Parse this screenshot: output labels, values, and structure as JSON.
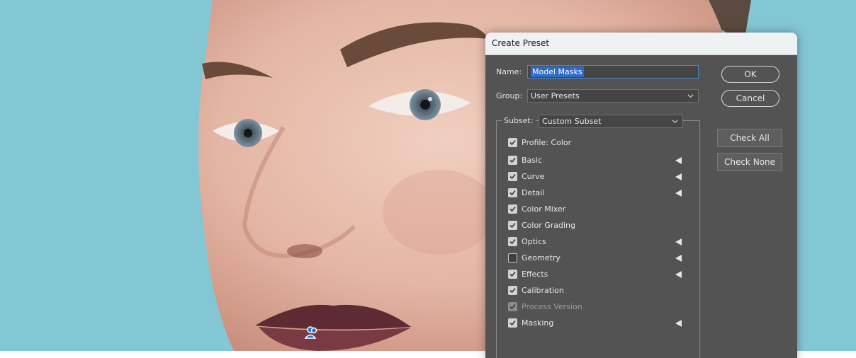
{
  "dialog": {
    "title": "Create Preset",
    "name_label": "Name:",
    "name_value": "Model Masks",
    "group_label": "Group:",
    "group_value": "User Presets",
    "subset_label": "Subset:",
    "subset_value": "Custom Subset",
    "buttons": {
      "ok": "OK",
      "cancel": "Cancel",
      "check_all": "Check All",
      "check_none": "Check None"
    },
    "items": [
      {
        "label": "Profile: Color",
        "checked": true,
        "enabled": true,
        "has_arrow": false
      },
      {
        "label": "Basic",
        "checked": true,
        "enabled": true,
        "has_arrow": true
      },
      {
        "label": "Curve",
        "checked": true,
        "enabled": true,
        "has_arrow": true
      },
      {
        "label": "Detail",
        "checked": true,
        "enabled": true,
        "has_arrow": true
      },
      {
        "label": "Color Mixer",
        "checked": true,
        "enabled": true,
        "has_arrow": false
      },
      {
        "label": "Color Grading",
        "checked": true,
        "enabled": true,
        "has_arrow": false
      },
      {
        "label": "Optics",
        "checked": true,
        "enabled": true,
        "has_arrow": true
      },
      {
        "label": "Geometry",
        "checked": false,
        "enabled": true,
        "has_arrow": true
      },
      {
        "label": "Effects",
        "checked": true,
        "enabled": true,
        "has_arrow": true
      },
      {
        "label": "Calibration",
        "checked": true,
        "enabled": true,
        "has_arrow": false
      },
      {
        "label": "Process Version",
        "checked": true,
        "enabled": false,
        "has_arrow": false
      },
      {
        "label": "Masking",
        "checked": true,
        "enabled": true,
        "has_arrow": true
      }
    ]
  },
  "colors": {
    "dialog_bg": "#535353",
    "titlebar_bg": "#eef2f2",
    "selection": "#2f6ac9",
    "backdrop": "#84c7d4"
  },
  "icons": {
    "photo_marker": "person-group-icon"
  }
}
